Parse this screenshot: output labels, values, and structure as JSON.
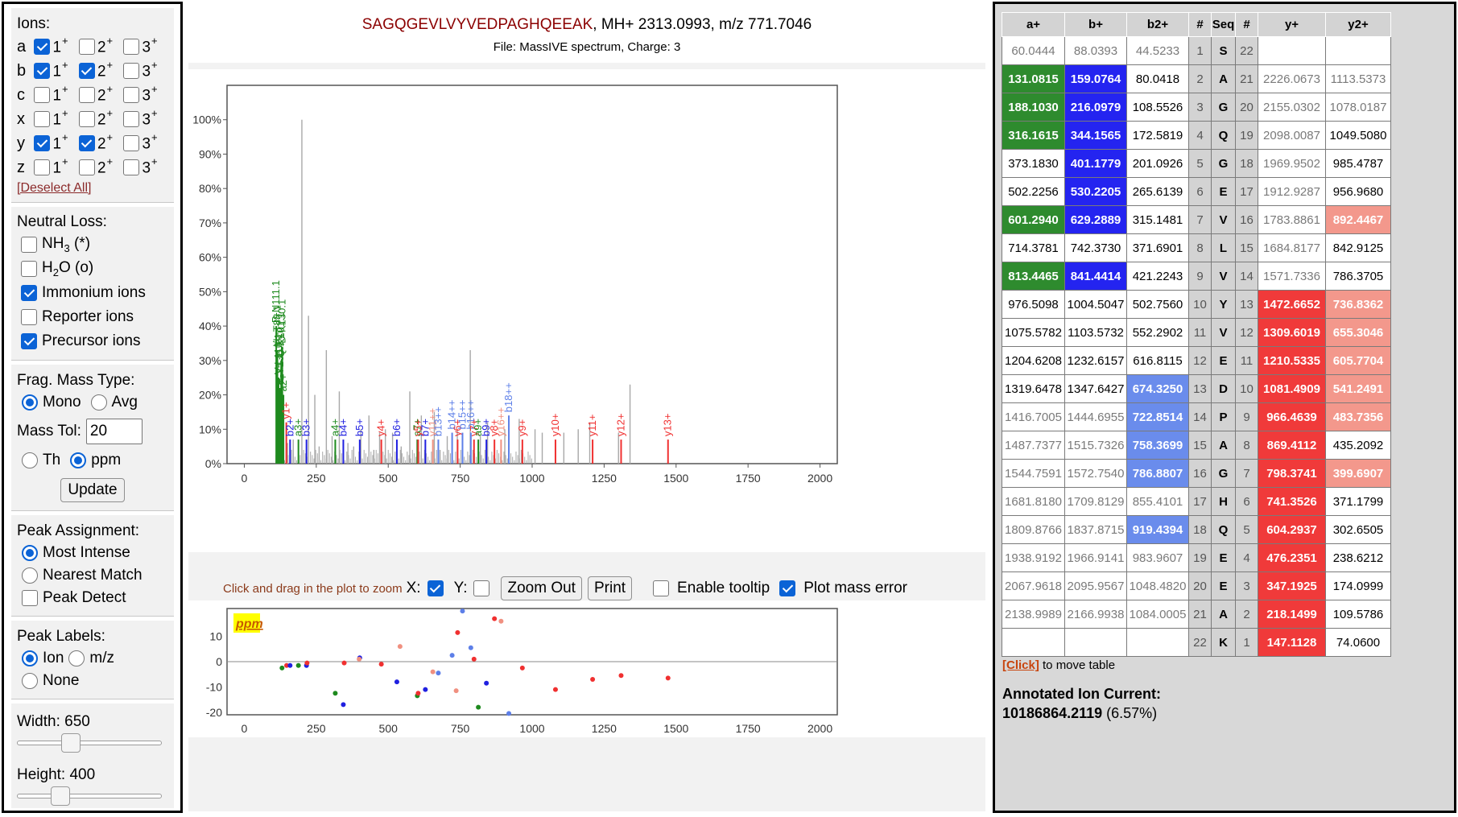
{
  "left_panel": {
    "ions_title": "Ions:",
    "ion_rows": [
      {
        "letter": "a",
        "checks": [
          true,
          false,
          false
        ]
      },
      {
        "letter": "b",
        "checks": [
          true,
          true,
          false
        ]
      },
      {
        "letter": "c",
        "checks": [
          false,
          false,
          false
        ]
      },
      {
        "letter": "x",
        "checks": [
          false,
          false,
          false
        ]
      },
      {
        "letter": "y",
        "checks": [
          true,
          true,
          false
        ]
      },
      {
        "letter": "z",
        "checks": [
          false,
          false,
          false
        ]
      }
    ],
    "charge_labels": [
      "1",
      "2",
      "3"
    ],
    "charge_sup": "+",
    "deselect_all": "[Deselect All]",
    "neutral_loss_title": "Neutral Loss:",
    "nh3_label": "NH3 (*)",
    "h2o_label": "H2O (o)",
    "immonium_label": "Immonium ions",
    "reporter_label": "Reporter ions",
    "precursor_label": "Precursor ions",
    "neutral_loss_checks": {
      "nh3": false,
      "h2o": false,
      "immonium": true,
      "reporter": false,
      "precursor": true
    },
    "frag_mass_type_title": "Frag. Mass Type:",
    "mono_label": "Mono",
    "avg_label": "Avg",
    "mass_type_selected": "Mono",
    "mass_tol_label": "Mass Tol:",
    "mass_tol_value": "20",
    "th_label": "Th",
    "ppm_label": "ppm",
    "tol_unit_selected": "ppm",
    "update_button": "Update",
    "peak_assignment_title": "Peak Assignment:",
    "most_intense_label": "Most Intense",
    "nearest_match_label": "Nearest Match",
    "peak_detect_label": "Peak Detect",
    "peak_assignment_selected": "Most Intense",
    "peak_detect_checked": false,
    "peak_labels_title": "Peak Labels:",
    "ion_label": "Ion",
    "mz_label": "m/z",
    "none_label": "None",
    "peak_labels_selected": "Ion",
    "width_label": "Width: 650",
    "width_value": 650,
    "width_fraction": 0.35,
    "height_label": "Height: 400",
    "height_value": 400,
    "height_fraction": 0.27
  },
  "header": {
    "peptide": "SAGQGEVLVYVEDPAGHQEEAK",
    "precursor_info": ", MH+ 2313.0993, m/z 771.7046",
    "file_info": "File: MassIVE spectrum, Charge: 3"
  },
  "controls": {
    "zoom_hint": "Click and drag in the plot to zoom",
    "x_label": "X:",
    "y_label": "Y:",
    "x_checked": true,
    "y_checked": false,
    "zoom_out": "Zoom Out",
    "print": "Print",
    "enable_tooltip": "Enable tooltip",
    "tooltip_checked": false,
    "plot_mass_error": "Plot mass error",
    "mass_error_checked": true
  },
  "colors": {
    "a_ion": "#1e8a1e",
    "b_ion": "#2020e0",
    "b2_ion": "#5d7fe8",
    "y_ion": "#f03030",
    "y2_ion": "#f09080",
    "unassigned": "#a8a8a8",
    "peptide": "#8b0000"
  },
  "chart_data": [
    {
      "type": "bar",
      "xlim": [
        -60,
        2060
      ],
      "ylim": [
        0,
        110
      ],
      "x_ticks": [
        0,
        250,
        500,
        750,
        1000,
        1250,
        1500,
        1750,
        2000
      ],
      "y_ticks": [
        0,
        10,
        20,
        30,
        40,
        50,
        60,
        70,
        80,
        90,
        100
      ],
      "y_tick_labels": [
        "0%",
        "10%",
        "20%",
        "30%",
        "40%",
        "50%",
        "60%",
        "70%",
        "80%",
        "90%",
        "100%"
      ],
      "unassigned_peaks": [
        [
          200,
          100
        ],
        [
          223,
          43
        ],
        [
          245,
          20
        ],
        [
          285,
          33
        ],
        [
          305,
          8
        ],
        [
          330,
          21
        ],
        [
          360,
          6
        ],
        [
          405,
          10
        ],
        [
          433,
          14
        ],
        [
          470,
          9
        ],
        [
          490,
          10
        ],
        [
          515,
          9
        ],
        [
          575,
          21
        ],
        [
          615,
          14
        ],
        [
          660,
          15
        ],
        [
          705,
          8
        ],
        [
          740,
          10
        ],
        [
          785,
          33
        ],
        [
          820,
          8
        ],
        [
          845,
          12
        ],
        [
          905,
          10
        ],
        [
          955,
          13
        ],
        [
          1010,
          10
        ],
        [
          1035,
          9
        ],
        [
          1110,
          9
        ],
        [
          1160,
          10
        ],
        [
          1200,
          12
        ],
        [
          1300,
          9
        ],
        [
          1340,
          23
        ],
        [
          150,
          6
        ],
        [
          170,
          7
        ],
        [
          260,
          5
        ],
        [
          380,
          5
        ],
        [
          450,
          4
        ],
        [
          545,
          5
        ],
        [
          680,
          4
        ]
      ],
      "annotated_peaks": [
        {
          "x": 111,
          "y": 40,
          "label": "P-N111.1",
          "kind": "a"
        },
        {
          "x": 115,
          "y": 33,
          "label": "I/L-T88.1",
          "kind": "a"
        },
        {
          "x": 119,
          "y": 25,
          "label": "V-L110.1",
          "kind": "a"
        },
        {
          "x": 124,
          "y": 22,
          "label": "E-Y136.1",
          "kind": "a"
        },
        {
          "x": 128,
          "y": 30,
          "label": "Q-K101.1",
          "kind": "a"
        },
        {
          "x": 132,
          "y": 34,
          "label": "D-K130.1",
          "kind": "a"
        },
        {
          "x": 136,
          "y": 20,
          "label": "a2+",
          "kind": "a"
        },
        {
          "x": 146,
          "y": 12,
          "label": "y1+",
          "kind": "y"
        },
        {
          "x": 159,
          "y": 7,
          "label": "b2+",
          "kind": "b"
        },
        {
          "x": 188,
          "y": 7,
          "label": "a3+",
          "kind": "a"
        },
        {
          "x": 216,
          "y": 7,
          "label": "b3+",
          "kind": "b"
        },
        {
          "x": 316,
          "y": 7,
          "label": "a4+",
          "kind": "a"
        },
        {
          "x": 344,
          "y": 7,
          "label": "b4+",
          "kind": "b"
        },
        {
          "x": 401,
          "y": 7,
          "label": "b5+",
          "kind": "b"
        },
        {
          "x": 476,
          "y": 7,
          "label": "y4+",
          "kind": "y"
        },
        {
          "x": 530,
          "y": 7,
          "label": "b6+",
          "kind": "b"
        },
        {
          "x": 601,
          "y": 7,
          "label": "a7+",
          "kind": "a"
        },
        {
          "x": 629,
          "y": 7,
          "label": "b7+",
          "kind": "b"
        },
        {
          "x": 604,
          "y": 7,
          "label": "y5+",
          "kind": "y"
        },
        {
          "x": 655,
          "y": 7,
          "label": "y11++",
          "kind": "y2"
        },
        {
          "x": 674,
          "y": 7,
          "label": "b13++",
          "kind": "b2"
        },
        {
          "x": 722,
          "y": 9,
          "label": "b14++",
          "kind": "b2"
        },
        {
          "x": 741,
          "y": 7,
          "label": "y6+",
          "kind": "y"
        },
        {
          "x": 758,
          "y": 9,
          "label": "b15++",
          "kind": "b2"
        },
        {
          "x": 787,
          "y": 9,
          "label": "b16++",
          "kind": "b2"
        },
        {
          "x": 798,
          "y": 7,
          "label": "y7+",
          "kind": "y"
        },
        {
          "x": 813,
          "y": 7,
          "label": "a9+",
          "kind": "a"
        },
        {
          "x": 841,
          "y": 7,
          "label": "b9+",
          "kind": "b"
        },
        {
          "x": 869,
          "y": 7,
          "label": "y8+",
          "kind": "y"
        },
        {
          "x": 892,
          "y": 7,
          "label": "y16++",
          "kind": "y2"
        },
        {
          "x": 919,
          "y": 14,
          "label": "b18++",
          "kind": "b2"
        },
        {
          "x": 966,
          "y": 7,
          "label": "y9+",
          "kind": "y"
        },
        {
          "x": 1081,
          "y": 7,
          "label": "y10+",
          "kind": "y"
        },
        {
          "x": 1210,
          "y": 7,
          "label": "y11+",
          "kind": "y"
        },
        {
          "x": 1309,
          "y": 7,
          "label": "y12+",
          "kind": "y"
        },
        {
          "x": 1472,
          "y": 7,
          "label": "y13+",
          "kind": "y"
        }
      ]
    },
    {
      "type": "scatter",
      "title": "ppm",
      "xlim": [
        -60,
        2060
      ],
      "ylim": [
        -21,
        21
      ],
      "x_ticks": [
        0,
        250,
        500,
        750,
        1000,
        1250,
        1500,
        1750,
        2000
      ],
      "y_ticks": [
        10,
        0,
        -10,
        -20
      ],
      "points": [
        {
          "x": 131,
          "y": -2.5,
          "kind": "a"
        },
        {
          "x": 147,
          "y": -1.5,
          "kind": "y"
        },
        {
          "x": 159,
          "y": -1.5,
          "kind": "b"
        },
        {
          "x": 188,
          "y": -1.5,
          "kind": "a"
        },
        {
          "x": 216,
          "y": -1.5,
          "kind": "b"
        },
        {
          "x": 218,
          "y": -0.5,
          "kind": "y"
        },
        {
          "x": 316,
          "y": -12.5,
          "kind": "a"
        },
        {
          "x": 344,
          "y": -17,
          "kind": "b"
        },
        {
          "x": 347,
          "y": -0.5,
          "kind": "y"
        },
        {
          "x": 401,
          "y": 1.5,
          "kind": "b"
        },
        {
          "x": 399,
          "y": 1,
          "kind": "y2"
        },
        {
          "x": 476,
          "y": -1,
          "kind": "y"
        },
        {
          "x": 530,
          "y": -8,
          "kind": "b"
        },
        {
          "x": 541,
          "y": 6,
          "kind": "y2"
        },
        {
          "x": 601,
          "y": -13.5,
          "kind": "a"
        },
        {
          "x": 604,
          "y": -12.5,
          "kind": "y"
        },
        {
          "x": 629,
          "y": -11,
          "kind": "b"
        },
        {
          "x": 655,
          "y": -4,
          "kind": "y2"
        },
        {
          "x": 674,
          "y": -4.5,
          "kind": "b2"
        },
        {
          "x": 722,
          "y": 2.5,
          "kind": "b2"
        },
        {
          "x": 736,
          "y": -11.5,
          "kind": "y2"
        },
        {
          "x": 741,
          "y": 11.5,
          "kind": "y"
        },
        {
          "x": 758,
          "y": 20,
          "kind": "b2"
        },
        {
          "x": 787,
          "y": 5.5,
          "kind": "b2"
        },
        {
          "x": 798,
          "y": 1,
          "kind": "y"
        },
        {
          "x": 813,
          "y": -18,
          "kind": "a"
        },
        {
          "x": 841,
          "y": -8.5,
          "kind": "b"
        },
        {
          "x": 869,
          "y": 17,
          "kind": "y"
        },
        {
          "x": 892,
          "y": 16,
          "kind": "y2"
        },
        {
          "x": 919,
          "y": -20.5,
          "kind": "b2"
        },
        {
          "x": 966,
          "y": -2.5,
          "kind": "y"
        },
        {
          "x": 1081,
          "y": -11,
          "kind": "y"
        },
        {
          "x": 1210,
          "y": -7,
          "kind": "y"
        },
        {
          "x": 1309,
          "y": -5.5,
          "kind": "y"
        },
        {
          "x": 1472,
          "y": -6.5,
          "kind": "y"
        }
      ]
    }
  ],
  "fragment_table": {
    "headers": [
      "a+",
      "b+",
      "b2+",
      "#",
      "Seq",
      "#",
      "y+",
      "y2+"
    ],
    "rows": [
      {
        "a": "60.0444",
        "b": "88.0393",
        "b2": "44.5233",
        "n": "1",
        "seq": "S",
        "rn": "22",
        "y": "",
        "y2": ""
      },
      {
        "a": "131.0815",
        "b": "159.0764",
        "b2": "80.0418",
        "n": "2",
        "seq": "A",
        "rn": "21",
        "y": "2226.0673",
        "y2": "1113.5373"
      },
      {
        "a": "188.1030",
        "b": "216.0979",
        "b2": "108.5526",
        "n": "3",
        "seq": "G",
        "rn": "20",
        "y": "2155.0302",
        "y2": "1078.0187"
      },
      {
        "a": "316.1615",
        "b": "344.1565",
        "b2": "172.5819",
        "n": "4",
        "seq": "Q",
        "rn": "19",
        "y": "2098.0087",
        "y2": "1049.5080"
      },
      {
        "a": "373.1830",
        "b": "401.1779",
        "b2": "201.0926",
        "n": "5",
        "seq": "G",
        "rn": "18",
        "y": "1969.9502",
        "y2": "985.4787"
      },
      {
        "a": "502.2256",
        "b": "530.2205",
        "b2": "265.6139",
        "n": "6",
        "seq": "E",
        "rn": "17",
        "y": "1912.9287",
        "y2": "956.9680"
      },
      {
        "a": "601.2940",
        "b": "629.2889",
        "b2": "315.1481",
        "n": "7",
        "seq": "V",
        "rn": "16",
        "y": "1783.8861",
        "y2": "892.4467"
      },
      {
        "a": "714.3781",
        "b": "742.3730",
        "b2": "371.6901",
        "n": "8",
        "seq": "L",
        "rn": "15",
        "y": "1684.8177",
        "y2": "842.9125"
      },
      {
        "a": "813.4465",
        "b": "841.4414",
        "b2": "421.2243",
        "n": "9",
        "seq": "V",
        "rn": "14",
        "y": "1571.7336",
        "y2": "786.3705"
      },
      {
        "a": "976.5098",
        "b": "1004.5047",
        "b2": "502.7560",
        "n": "10",
        "seq": "Y",
        "rn": "13",
        "y": "1472.6652",
        "y2": "736.8362"
      },
      {
        "a": "1075.5782",
        "b": "1103.5732",
        "b2": "552.2902",
        "n": "11",
        "seq": "V",
        "rn": "12",
        "y": "1309.6019",
        "y2": "655.3046"
      },
      {
        "a": "1204.6208",
        "b": "1232.6157",
        "b2": "616.8115",
        "n": "12",
        "seq": "E",
        "rn": "11",
        "y": "1210.5335",
        "y2": "605.7704"
      },
      {
        "a": "1319.6478",
        "b": "1347.6427",
        "b2": "674.3250",
        "n": "13",
        "seq": "D",
        "rn": "10",
        "y": "1081.4909",
        "y2": "541.2491"
      },
      {
        "a": "1416.7005",
        "b": "1444.6955",
        "b2": "722.8514",
        "n": "14",
        "seq": "P",
        "rn": "9",
        "y": "966.4639",
        "y2": "483.7356"
      },
      {
        "a": "1487.7377",
        "b": "1515.7326",
        "b2": "758.3699",
        "n": "15",
        "seq": "A",
        "rn": "8",
        "y": "869.4112",
        "y2": "435.2092"
      },
      {
        "a": "1544.7591",
        "b": "1572.7540",
        "b2": "786.8807",
        "n": "16",
        "seq": "G",
        "rn": "7",
        "y": "798.3741",
        "y2": "399.6907"
      },
      {
        "a": "1681.8180",
        "b": "1709.8129",
        "b2": "855.4101",
        "n": "17",
        "seq": "H",
        "rn": "6",
        "y": "741.3526",
        "y2": "371.1799"
      },
      {
        "a": "1809.8766",
        "b": "1837.8715",
        "b2": "919.4394",
        "n": "18",
        "seq": "Q",
        "rn": "5",
        "y": "604.2937",
        "y2": "302.6505"
      },
      {
        "a": "1938.9192",
        "b": "1966.9141",
        "b2": "983.9607",
        "n": "19",
        "seq": "E",
        "rn": "4",
        "y": "476.2351",
        "y2": "238.6212"
      },
      {
        "a": "2067.9618",
        "b": "2095.9567",
        "b2": "1048.4820",
        "n": "20",
        "seq": "E",
        "rn": "3",
        "y": "347.1925",
        "y2": "174.0999"
      },
      {
        "a": "2138.9989",
        "b": "2166.9938",
        "b2": "1084.0005",
        "n": "21",
        "seq": "A",
        "rn": "2",
        "y": "218.1499",
        "y2": "109.5786"
      },
      {
        "a": "",
        "b": "",
        "b2": "",
        "n": "22",
        "seq": "K",
        "rn": "1",
        "y": "147.1128",
        "y2": "74.0600"
      }
    ],
    "highlight": {
      "a": [
        1,
        2,
        3,
        6,
        8
      ],
      "b": [
        1,
        2,
        3,
        4,
        5,
        6,
        8
      ],
      "b2": [
        12,
        13,
        14,
        15,
        17
      ],
      "y": [
        9,
        10,
        11,
        12,
        13,
        14,
        15,
        16,
        17,
        18,
        19,
        20,
        21
      ],
      "y2": [
        6,
        9,
        10,
        11,
        12,
        13,
        15
      ]
    },
    "dim_rows": [
      0,
      13,
      14,
      15,
      16,
      17,
      18,
      19,
      20
    ],
    "move_link": "[Click]",
    "move_text": " to move table",
    "aic_label": "Annotated Ion Current:",
    "aic_value": "10186864.2119",
    "aic_percent": " (6.57%)"
  }
}
